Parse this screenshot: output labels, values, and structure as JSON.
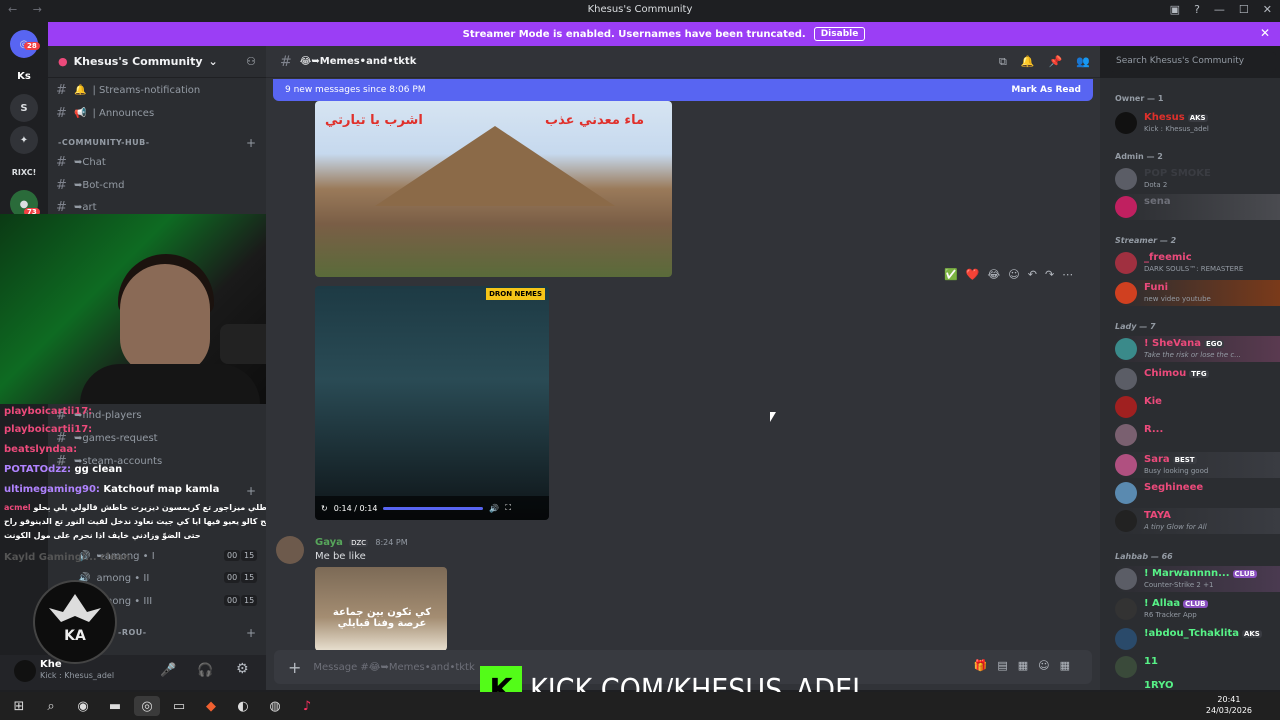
{
  "window": {
    "title": "Khesus's Community"
  },
  "banner": {
    "text": "Streamer Mode is enabled. Usernames have been truncated.",
    "button": "Disable"
  },
  "servers": [
    {
      "label": "Ks"
    },
    {
      "label": "RIXC!"
    }
  ],
  "server_badges": {
    "top": "28",
    "mid": "73"
  },
  "sidebar": {
    "server_name": "Khesus's Community",
    "top_channels": [
      {
        "label": "| Streams-notification"
      },
      {
        "label": "| Announces"
      }
    ],
    "category_hub": "-COMMUNITY-HUB-",
    "hub_channels": [
      {
        "label": "➥Chat"
      },
      {
        "label": "➥Bot-cmd"
      },
      {
        "label": "➥art"
      }
    ],
    "mid_channels": [
      {
        "label": "➥find-players"
      },
      {
        "label": "➥games-request"
      },
      {
        "label": "➥steam-accounts"
      }
    ],
    "voice_channels": [
      {
        "label": "➥among • I",
        "c1": "00",
        "c2": "15"
      },
      {
        "label": "among • II",
        "c1": "00",
        "c2": "15"
      },
      {
        "label": "among • III",
        "c1": "00",
        "c2": "15"
      }
    ],
    "category_rou": "-ROU-"
  },
  "user_panel": {
    "name": "Khe",
    "sub": "Kick : Khesus_adel"
  },
  "chat_overlay": [
    {
      "user": "playboicartii17:",
      "text": ""
    },
    {
      "user": "playboicartii17:",
      "text": ""
    },
    {
      "user": "beatslyndaa:",
      "text": ""
    },
    {
      "user": "POTATOdzz:",
      "text": "gg clean"
    },
    {
      "user": "ultimegaming90:",
      "text": "Katchouf map kamla"
    },
    {
      "user": "acmel",
      "text": "كنت نقسطلي ميزاجور تع كريمسون ديزيرت خاطش قالولي يلي بحلو"
    },
    {
      "user": "",
      "text": "بزاف صوالح كالو يعيو فيها ايا كي جيت نعاود ندخل لقيت النور تع الدينوقو راح"
    },
    {
      "user": "",
      "text": "حتى الضوّ وزادني خايف اذا نحرم على مول الكونت"
    },
    {
      "user": "Kayld",
      "text": "Gamingl... clean"
    }
  ],
  "main": {
    "channel": "😂➥Memes•and•tktk",
    "new_messages": "9 new messages since 8:06 PM",
    "mark_read": "Mark As Read",
    "image1_text_right": "ماء معدني عذب",
    "image1_text_left": "اشرب يا تيارتي",
    "video_watermark": "DRON NEMES",
    "video_time": "0:14 / 0:14",
    "video_progress": 1.0,
    "msg_author": "Gaya",
    "msg_tag": "DZC",
    "msg_time": "8:24 PM",
    "msg_text": "Me be like",
    "img2_caption": "كي تكون بين جماعة عرصة وفنا قبايلي"
  },
  "composer": {
    "placeholder": "Message #😂➥Memes•and•tktk"
  },
  "search": {
    "placeholder": "Search Khesus's Community"
  },
  "kick": {
    "logo": "K",
    "text": "KICK.COM/KHESUS_ADEL"
  },
  "members": {
    "owner_header": "Owner — 1",
    "owner": [
      {
        "name": "Khesus",
        "tag": "AKS",
        "status": "Kick : Khesus_adel",
        "color": "#e0302b"
      }
    ],
    "admin_header": "Admin — 2",
    "admin": [
      {
        "name": "POP SMOKE",
        "tag": "",
        "status": "Dota 2",
        "color": "#2b2d31"
      },
      {
        "name": "sena",
        "tag": "",
        "status": "",
        "color": "#6d6f78"
      }
    ],
    "streamer_header": "Streamer — 2",
    "streamer": [
      {
        "name": "_freemic",
        "tag": "",
        "status": "DARK SOULS™: REMASTERE",
        "color": "#ec4a7b"
      },
      {
        "name": "Funi",
        "tag": "",
        "status": "new video youtube",
        "color": "#ec4a7b"
      }
    ],
    "lady_header": "Lady — 7",
    "lady": [
      {
        "name": "! SheVana",
        "tag": "EGO",
        "status": "Take the risk or lose the c...",
        "color": "#ec4a7b"
      },
      {
        "name": "Chimou",
        "tag": "TFG",
        "status": "",
        "color": "#ec4a7b"
      },
      {
        "name": "Kie",
        "tag": "",
        "status": "",
        "color": "#ec4a7b"
      },
      {
        "name": "R...",
        "tag": "",
        "status": "",
        "color": "#ec4a7b"
      },
      {
        "name": "Sara",
        "tag": "BEST",
        "status": "Busy looking good",
        "color": "#ec4a7b"
      },
      {
        "name": "Seghineee",
        "tag": "",
        "status": "",
        "color": "#ec4a7b"
      },
      {
        "name": "TAYA",
        "tag": "",
        "status": "A tiny Glow for All",
        "color": "#ec4a7b"
      }
    ],
    "lahbab_header": "Lahbab — 66",
    "lahbab": [
      {
        "name": "! Marwannnn...",
        "tag": "CLUB",
        "status": "Counter-Strike 2 +1",
        "color": "#57f287"
      },
      {
        "name": "! Allaa",
        "tag": "CLUB",
        "status": "R6 Tracker App",
        "color": "#57f287"
      },
      {
        "name": "!abdou_Tchaklita",
        "tag": "AKS",
        "status": "",
        "color": "#57f287"
      },
      {
        "name": "11",
        "tag": "",
        "status": "",
        "color": "#57f287"
      },
      {
        "name": "1RYO",
        "tag": "",
        "status": "",
        "color": "#57f287"
      }
    ]
  },
  "taskbar": {
    "time": "20:41",
    "date": "24/03/2026"
  }
}
